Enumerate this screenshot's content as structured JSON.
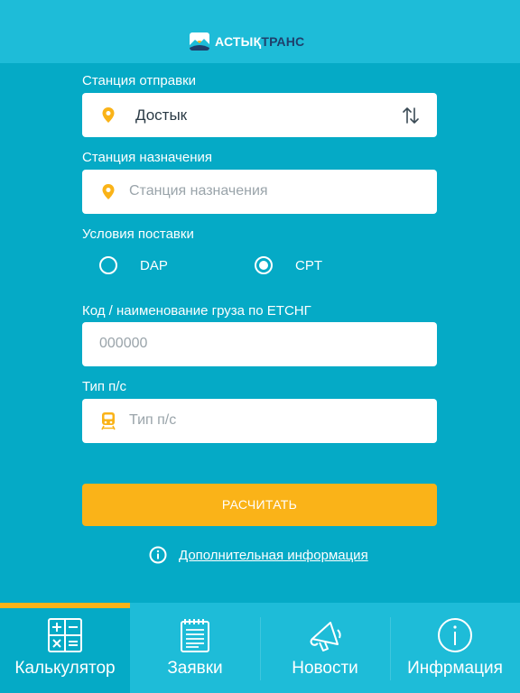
{
  "header": {
    "brand_part1": "АСТЫҚ",
    "brand_part2": "ТРАНС",
    "logo_icon": "mountain-sun-logo-icon"
  },
  "form": {
    "departure": {
      "label": "Станция отправки",
      "value": "Достык",
      "icon": "location-pin-icon",
      "swap_icon": "swap-arrows-icon"
    },
    "destination": {
      "label": "Станция назначения",
      "placeholder": "Станция назначения",
      "icon": "location-pin-icon"
    },
    "delivery": {
      "label": "Условия поставки",
      "options": [
        {
          "label": "DAP",
          "selected": false
        },
        {
          "label": "CPT",
          "selected": true
        }
      ]
    },
    "cargo": {
      "label": "Код / наименование груза по ЕТСНГ",
      "placeholder": "000000"
    },
    "wagon": {
      "label": "Тип п/с",
      "placeholder": "Тип п/с",
      "icon": "train-icon"
    }
  },
  "actions": {
    "calculate": "РАСЧИТАТЬ",
    "more_info": "Дополнительная информация"
  },
  "tabs": [
    {
      "label": "Калькулятор",
      "icon": "calculator-icon",
      "active": true
    },
    {
      "label": "Заявки",
      "icon": "notepad-icon",
      "active": false
    },
    {
      "label": "Новости",
      "icon": "megaphone-icon",
      "active": false
    },
    {
      "label": "Инфрмация",
      "icon": "info-icon",
      "active": false
    }
  ],
  "colors": {
    "background": "#05aac6",
    "header": "#1ebcd8",
    "accent": "#fab318",
    "brand_dark": "#1f3f6b"
  }
}
